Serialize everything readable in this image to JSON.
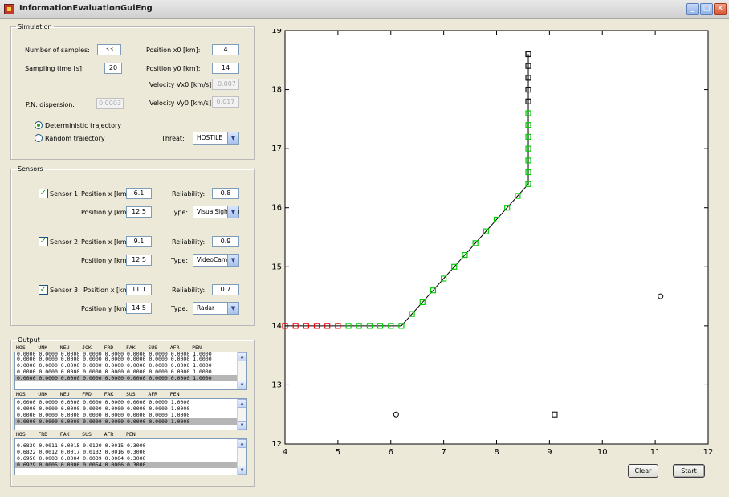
{
  "window": {
    "title": "InformationEvaluationGuiEng"
  },
  "simulation": {
    "legend": "Simulation",
    "num_samples_label": "Number of samples:",
    "num_samples": "33",
    "sampling_time_label": "Sampling time [s]:",
    "sampling_time": "20",
    "pn_dispersion_label": "P.N. dispersion:",
    "pn_dispersion": "0.0003",
    "pos_x0_label": "Position x0 [km]:",
    "pos_x0": "4",
    "pos_y0_label": "Position y0 [km]:",
    "pos_y0": "14",
    "vx0_label": "Velocity Vx0 [km/s]:",
    "vx0": "-0.007",
    "vy0_label": "Velocity Vy0 [km/s]:",
    "vy0": "0.017",
    "deterministic_label": "Deterministic trajectory",
    "deterministic_selected": true,
    "random_label": "Random trajectory",
    "threat_label": "Threat:",
    "threat_value": "HOSTILE"
  },
  "sensors": {
    "legend": "Sensors",
    "items": [
      {
        "label": "Sensor 1:",
        "checked": true,
        "pos_x_label": "Position x [km]:",
        "pos_x": "6.1",
        "pos_y_label": "Position y [km]:",
        "pos_y": "12.5",
        "reliability_label": "Reliability:",
        "reliability": "0.8",
        "type_label": "Type:",
        "type": "VisualSighting"
      },
      {
        "label": "Sensor 2:",
        "checked": true,
        "pos_x_label": "Position x [km]:",
        "pos_x": "9.1",
        "pos_y_label": "Position y [km]:",
        "pos_y": "12.5",
        "reliability_label": "Reliability:",
        "reliability": "0.9",
        "type_label": "Type:",
        "type": "VideoCamera"
      },
      {
        "label": "Sensor 3:",
        "checked": true,
        "pos_x_label": "Position x [km]:",
        "pos_x": "11.1",
        "pos_y_label": "Position y [km]:",
        "pos_y": "14.5",
        "reliability_label": "Reliability:",
        "reliability": "0.7",
        "type_label": "Type:",
        "type": "Radar"
      }
    ]
  },
  "output": {
    "legend": "Output",
    "table1": {
      "header": "HOS    UNK    NEU    JOK    FRD    FAK    SUS    AFR    PEN",
      "rows": [
        "0.0000 0.0000 0.0000 0.0000 0.0000 0.0000 0.0000 0.0000 1.0000",
        "0.0000 0.0000 0.0000 0.0000 0.0000 0.0000 0.0000 0.0000 1.0000",
        "0.0000 0.0000 0.0000 0.0000 0.0000 0.0000 0.0000 0.0000 1.0000",
        "0.0000 0.0000 0.0000 0.0000 0.0000 0.0000 0.0000 0.0000 1.0000",
        "0.0000 0.0000 0.0000 0.0000 0.0000 0.0000 0.0000 0.0000 1.0000"
      ]
    },
    "table2": {
      "header": "HOS    UNK    NEU    FRD    FAK    SUS    AFR    PEN",
      "rows": [
        "0.0000 0.0000 0.0000 0.0000 0.0000 0.0000 0.0000 1.0000",
        "0.0000 0.0000 0.0000 0.0000 0.0000 0.0000 0.0000 1.0000",
        "0.0000 0.0000 0.0000 0.0000 0.0000 0.0000 0.0000 1.0000",
        "0.0000 0.0000 0.0000 0.0000 0.0000 0.0000 0.0000 1.0000"
      ]
    },
    "table3": {
      "header": "HOS    FRD    FAK    SUS    AFR    PEN",
      "rows": [
        "0.6839 0.0011 0.0015 0.0120 0.0015 0.3000",
        "0.6822 0.0012 0.0017 0.0132 0.0016 0.3000",
        "0.6950 0.0003 0.0004 0.0039 0.0004 0.3000",
        "0.6929 0.0005 0.0006 0.0054 0.0006 0.3000"
      ]
    }
  },
  "buttons": {
    "clear": "Clear",
    "start": "Start"
  },
  "chart_data": {
    "type": "scatter",
    "xlim": [
      4,
      12
    ],
    "ylim": [
      12,
      19
    ],
    "xticks": [
      "4",
      "5",
      "6",
      "7",
      "8",
      "9",
      "10",
      "11",
      "12"
    ],
    "yticks": [
      "12",
      "13",
      "14",
      "15",
      "16",
      "17",
      "18",
      "19"
    ],
    "grid": false,
    "series": [
      {
        "marker": "square",
        "line_color": "#000000",
        "marker_colors": [
          "#e8000b",
          "#ff0000",
          "#00cc00",
          "#000000"
        ],
        "x": [
          4.0,
          4.2,
          4.4,
          4.6,
          4.8,
          5.0,
          5.2,
          5.4,
          5.6,
          5.8,
          6.0,
          6.2,
          6.4,
          6.6,
          6.8,
          7.0,
          7.2,
          7.4,
          7.6,
          7.8,
          8.0,
          8.2,
          8.4,
          8.6,
          8.6,
          8.6,
          8.6,
          8.6,
          8.6,
          8.6,
          8.6,
          8.6,
          8.6,
          8.6,
          8.6,
          8.6
        ],
        "y": [
          14.0,
          14.0,
          14.0,
          14.0,
          14.0,
          14.0,
          14.0,
          14.0,
          14.0,
          14.0,
          14.0,
          14.0,
          14.2,
          14.4,
          14.6,
          14.8,
          15.0,
          15.2,
          15.4,
          15.6,
          15.8,
          16.0,
          16.2,
          16.4,
          16.6,
          16.8,
          17.0,
          17.2,
          17.4,
          17.6,
          17.8,
          18.0,
          18.2,
          18.4,
          18.6,
          18.6
        ],
        "marker_fill": [
          "red",
          "red",
          "red",
          "red",
          "red",
          "red",
          "green",
          "green",
          "green",
          "green",
          "green",
          "green",
          "green",
          "green",
          "green",
          "green",
          "green",
          "green",
          "green",
          "green",
          "green",
          "green",
          "green",
          "green",
          "green",
          "green",
          "green",
          "green",
          "green",
          "green",
          "black",
          "black",
          "black",
          "black",
          "black",
          "black"
        ]
      },
      {
        "marker": "circle",
        "x": [
          6.1,
          11.1
        ],
        "y": [
          12.5,
          14.5
        ]
      },
      {
        "marker": "square-open",
        "x": [
          9.1
        ],
        "y": [
          12.5
        ]
      }
    ]
  }
}
